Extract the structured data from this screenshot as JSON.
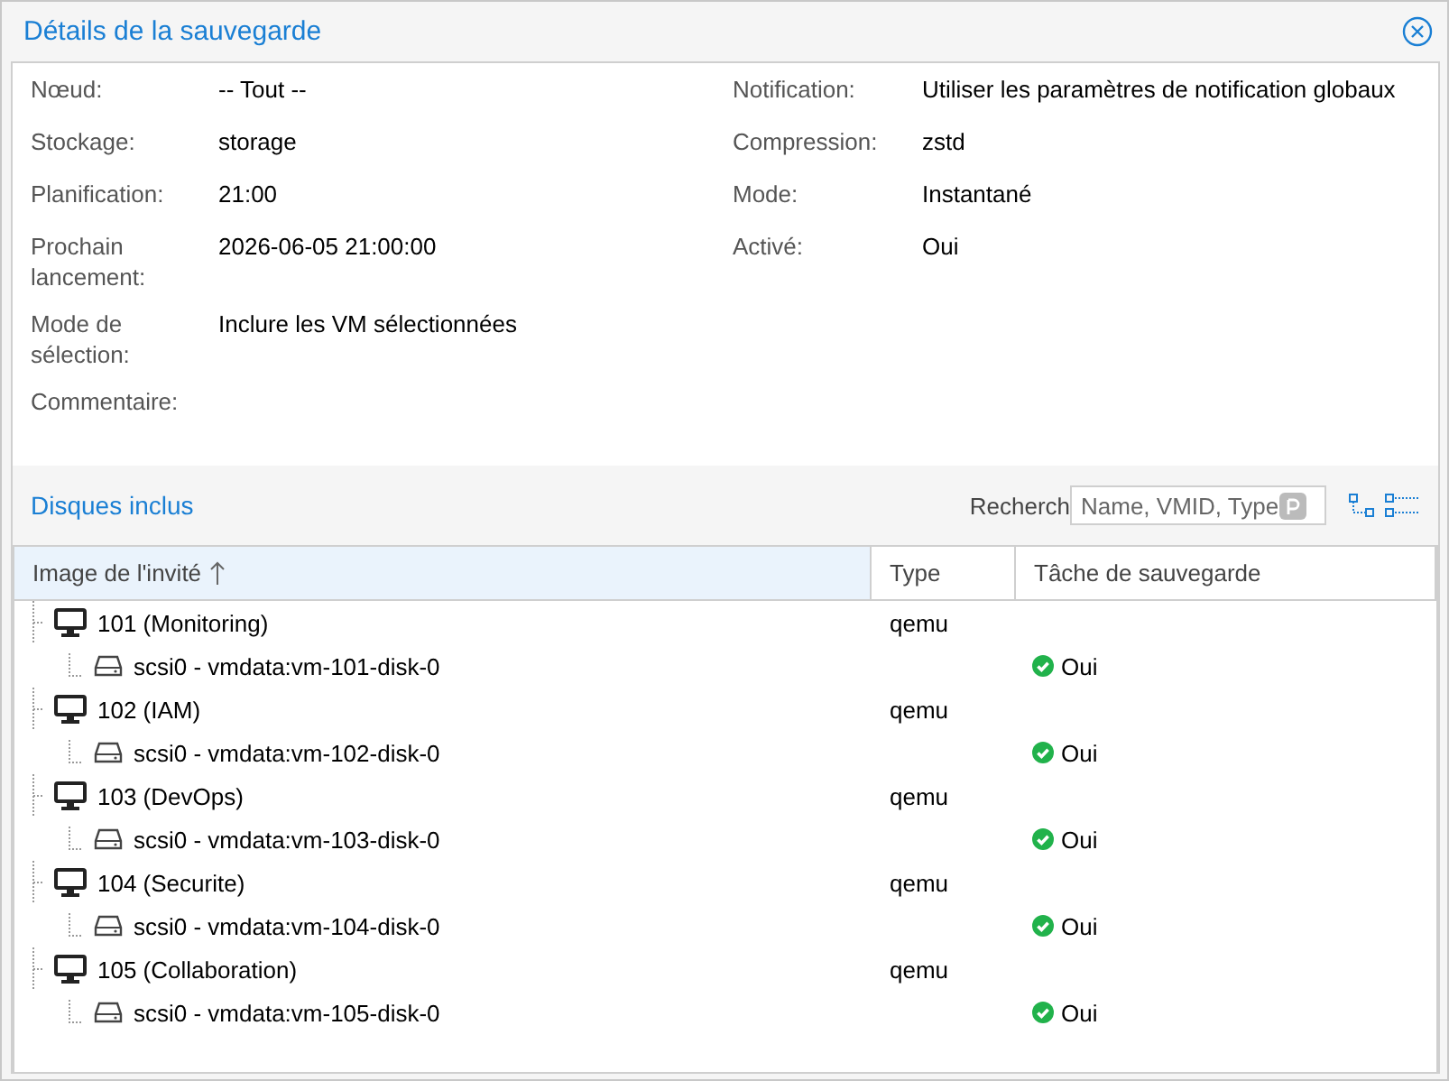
{
  "window": {
    "title": "Détails de la sauvegarde"
  },
  "details": {
    "left": [
      {
        "label": "Nœud:",
        "value": "-- Tout --"
      },
      {
        "label": "Stockage:",
        "value": "storage"
      },
      {
        "label": "Planification:",
        "value": "21:00"
      },
      {
        "label": "Prochain lancement:",
        "value": "2026-06-05 21:00:00"
      },
      {
        "label": "Mode de sélection:",
        "value": "Inclure les VM sélectionnées"
      },
      {
        "label": "Commentaire:"
      }
    ],
    "right": [
      {
        "label": "Notification:",
        "value": "Utiliser les paramètres de notification globaux"
      },
      {
        "label": "Compression:",
        "value": "zstd"
      },
      {
        "label": "Mode:",
        "value": "Instantané"
      },
      {
        "label": "Activé:",
        "value": "Oui"
      }
    ]
  },
  "disks": {
    "title": "Disques inclus",
    "search_label": "Recherch",
    "search": {
      "placeholder": "Name, VMID, Type"
    },
    "columns": [
      {
        "label": "Image de l'invité",
        "sorted": true
      },
      {
        "label": "Type",
        "sorted": false
      },
      {
        "label": "Tâche de sauvegarde",
        "sorted": false
      }
    ],
    "rows": [
      {
        "name": "101 (Monitoring)",
        "type": "qemu",
        "children": [
          {
            "name": "scsi0 - vmdata:vm-101-disk-0",
            "backup": "Oui"
          }
        ]
      },
      {
        "name": "102 (IAM)",
        "type": "qemu",
        "children": [
          {
            "name": "scsi0 - vmdata:vm-102-disk-0",
            "backup": "Oui"
          }
        ]
      },
      {
        "name": "103 (DevOps)",
        "type": "qemu",
        "children": [
          {
            "name": "scsi0 - vmdata:vm-103-disk-0",
            "backup": "Oui"
          }
        ]
      },
      {
        "name": "104 (Securite)",
        "type": "qemu",
        "children": [
          {
            "name": "scsi0 - vmdata:vm-104-disk-0",
            "backup": "Oui"
          }
        ]
      },
      {
        "name": "105 (Collaboration)",
        "type": "qemu",
        "children": [
          {
            "name": "scsi0 - vmdata:vm-105-disk-0",
            "backup": "Oui"
          }
        ]
      }
    ]
  }
}
